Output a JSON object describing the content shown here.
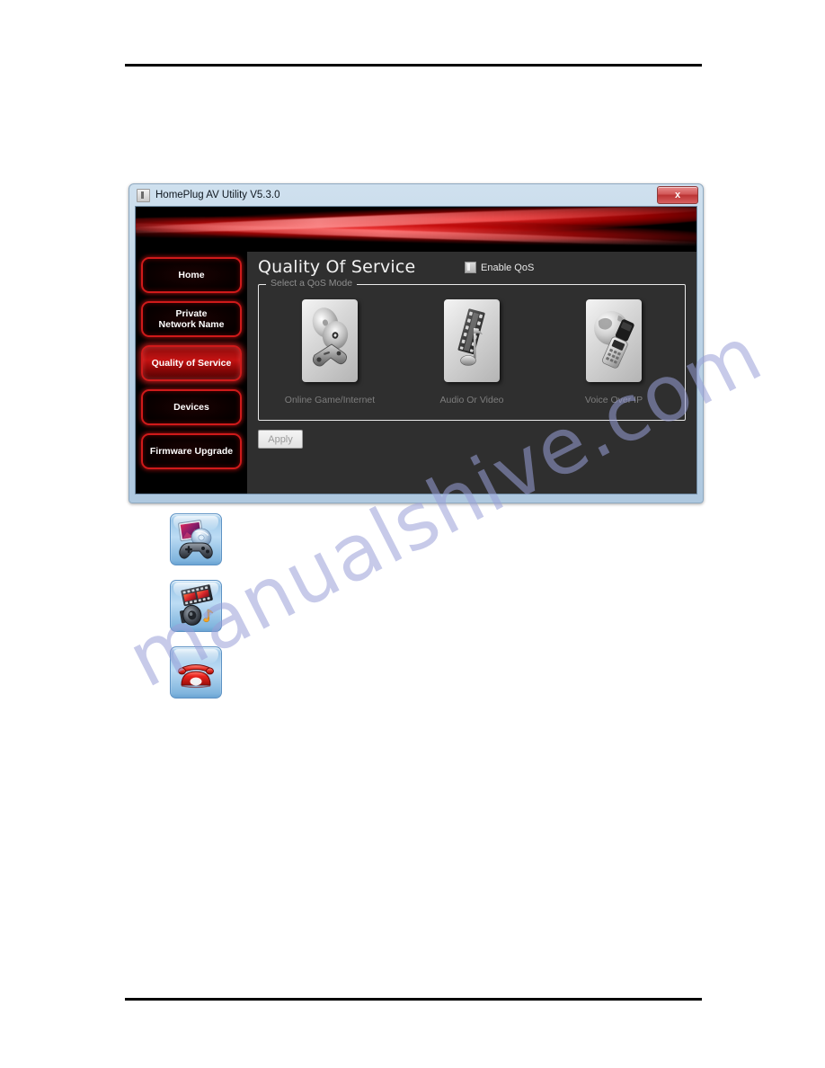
{
  "page": {
    "background": "#ffffff",
    "rule_color": "#000000",
    "watermark": "manualshive.com"
  },
  "window": {
    "title": "HomePlug AV Utility V5.3.0",
    "title_icon": "app-icon",
    "close_label": "x",
    "frame_color": "#bcd3e6",
    "client_background": "#000000",
    "banner_accent": "#cc0000"
  },
  "sidebar": {
    "items": [
      {
        "label": "Home",
        "active": false
      },
      {
        "label": "Private\nNetwork Name",
        "line1": "Private",
        "line2": "Network Name",
        "active": false
      },
      {
        "label": "Quality of Service",
        "active": true
      },
      {
        "label": "Devices",
        "active": false
      },
      {
        "label": "Firmware Upgrade",
        "active": false
      }
    ],
    "active_color": "#c41212",
    "border_color": "#cf1a1a"
  },
  "content": {
    "page_title": "Quality Of Service",
    "enable_qos_label": "Enable QoS",
    "enable_qos_checked": true,
    "groupbox_legend": "Select a QoS Mode",
    "modes": [
      {
        "label": "Online Game/Internet",
        "icon": "game-disc-icon",
        "selected": false
      },
      {
        "label": "Audio Or Video",
        "icon": "film-note-icon",
        "selected": false
      },
      {
        "label": "Voice Over IP",
        "icon": "globe-phone-icon",
        "selected": false
      }
    ],
    "apply_label": "Apply",
    "apply_enabled": false,
    "panel_background": "#2f2f2f"
  },
  "legend_icons": [
    {
      "name": "online-game-internet-icon",
      "caption": ""
    },
    {
      "name": "audio-video-icon",
      "caption": ""
    },
    {
      "name": "voice-over-ip-icon",
      "caption": ""
    }
  ]
}
